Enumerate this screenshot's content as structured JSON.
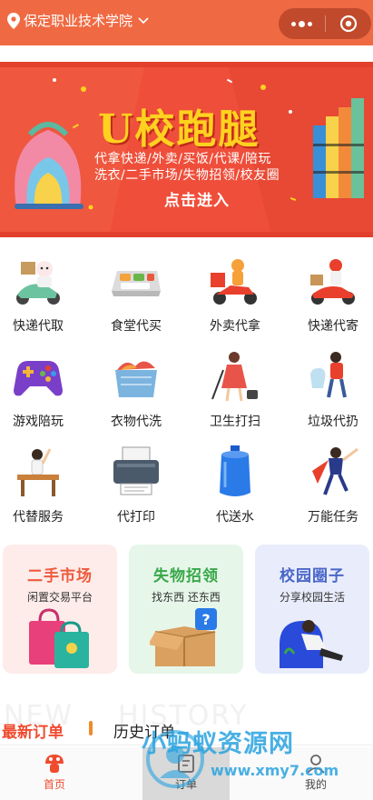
{
  "header": {
    "location": "保定职业技术学院",
    "colors": {
      "bar": "#ef6a43",
      "capsule": "#c14a2c"
    }
  },
  "banner": {
    "title": "U校跑腿",
    "line1": "代拿快递/外卖/买饭/代课/陪玩",
    "line2": "洗衣/二手市场/失物招领/校友圈",
    "cta": "点击进入"
  },
  "services": [
    {
      "label": "快递代取",
      "icon": "scooter-delivery-icon"
    },
    {
      "label": "食堂代买",
      "icon": "meal-tray-icon"
    },
    {
      "label": "外卖代拿",
      "icon": "delivery-rider-icon"
    },
    {
      "label": "快递代寄",
      "icon": "courier-scooter-icon"
    },
    {
      "label": "游戏陪玩",
      "icon": "gamepad-icon"
    },
    {
      "label": "衣物代洗",
      "icon": "laundry-basket-icon"
    },
    {
      "label": "卫生打扫",
      "icon": "vacuum-cleaner-icon"
    },
    {
      "label": "垃圾代扔",
      "icon": "trash-bag-icon"
    },
    {
      "label": "代替服务",
      "icon": "student-desk-icon"
    },
    {
      "label": "代打印",
      "icon": "printer-icon"
    },
    {
      "label": "代送水",
      "icon": "water-bucket-icon"
    },
    {
      "label": "万能任务",
      "icon": "superhero-icon"
    }
  ],
  "cards": [
    {
      "title": "二手市场",
      "subtitle": "闲置交易平台",
      "color": "#ef5a3c",
      "bg": "#fdecea"
    },
    {
      "title": "失物招领",
      "subtitle": "找东西 还东西",
      "color": "#3aa84a",
      "bg": "#e6f6e9"
    },
    {
      "title": "校园圈子",
      "subtitle": "分享校园生活",
      "color": "#4a67c8",
      "bg": "#e9ecfb"
    }
  ],
  "orders": {
    "bg_left": "NEW",
    "bg_right": "HISTORY",
    "latest": "最新订单",
    "history": "历史订单"
  },
  "tabbar": {
    "home": "首页",
    "middle": "订单",
    "mine": "我的"
  },
  "watermark": {
    "text": "小蚂蚁资源网",
    "url": "www.xmy7.com"
  }
}
